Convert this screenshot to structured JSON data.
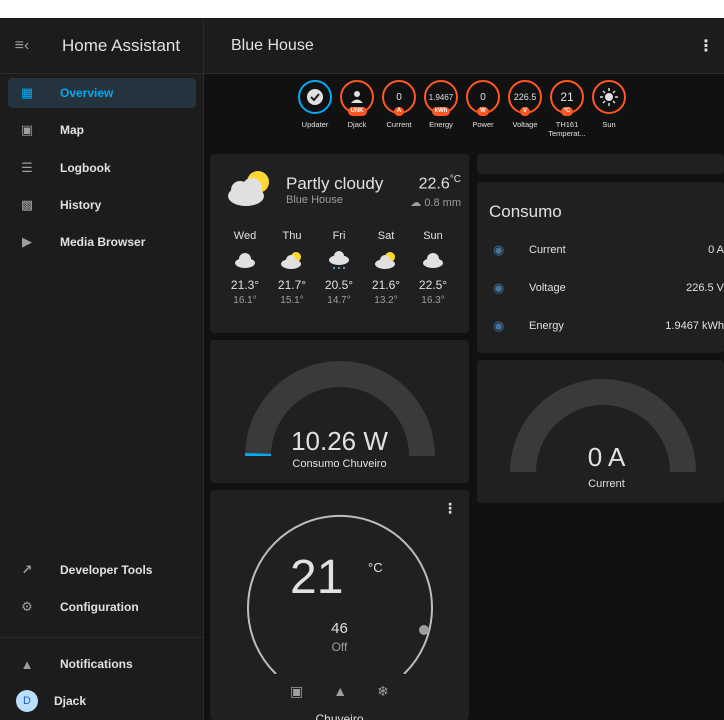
{
  "sidebar": {
    "title": "Home Assistant",
    "items": [
      {
        "label": "Overview",
        "icon": "view-dashboard-icon"
      },
      {
        "label": "Map",
        "icon": "map-icon"
      },
      {
        "label": "Logbook",
        "icon": "logbook-icon"
      },
      {
        "label": "History",
        "icon": "history-icon"
      },
      {
        "label": "Media Browser",
        "icon": "media-browser-icon"
      }
    ],
    "bottom": [
      {
        "label": "Developer Tools",
        "icon": "hammer-icon"
      },
      {
        "label": "Configuration",
        "icon": "cog-icon"
      },
      {
        "label": "Notifications",
        "icon": "bell-icon"
      }
    ],
    "user": {
      "name": "Djack",
      "initial": "D"
    }
  },
  "header": {
    "title": "Blue House"
  },
  "badges": [
    {
      "label": "Updater",
      "value": "",
      "unit": "",
      "icon": "check-icon"
    },
    {
      "label": "Djack",
      "value": "",
      "unit": "UNK",
      "icon": "person-icon"
    },
    {
      "label": "Current",
      "value": "0",
      "unit": "A"
    },
    {
      "label": "Energy",
      "value": "1.9467",
      "unit": "kWh"
    },
    {
      "label": "Power",
      "value": "0",
      "unit": "W"
    },
    {
      "label": "Voltage",
      "value": "226.5",
      "unit": "V"
    },
    {
      "label": "TH161 Temperat...",
      "value": "21",
      "unit": "°C"
    },
    {
      "label": "Sun",
      "value": "",
      "unit": "",
      "icon": "sun-icon"
    }
  ],
  "weather": {
    "condition": "Partly cloudy",
    "location": "Blue House",
    "temperature": "22.6",
    "temp_unit": "°C",
    "precipitation": "0.8 mm",
    "forecast": [
      {
        "day": "Wed",
        "high": "21.3°",
        "low": "16.1°",
        "icon": "cloud-icon"
      },
      {
        "day": "Thu",
        "high": "21.7°",
        "low": "15.1°",
        "icon": "partly-cloudy-icon"
      },
      {
        "day": "Fri",
        "high": "20.5°",
        "low": "14.7°",
        "icon": "snowy-icon"
      },
      {
        "day": "Sat",
        "high": "21.6°",
        "low": "13.2°",
        "icon": "partly-cloudy-icon"
      },
      {
        "day": "Sun",
        "high": "22.5°",
        "low": "16.3°",
        "icon": "cloud-icon"
      }
    ]
  },
  "gauge_power": {
    "value": "10.26 W",
    "name": "Consumo Chuveiro",
    "fraction": 0.01
  },
  "thermostat": {
    "current": "21",
    "unit": "°C",
    "target": "46",
    "state": "Off",
    "name": "Chuveiro"
  },
  "consumo": {
    "title": "Consumo",
    "entities": [
      {
        "name": "Current",
        "value": "0 A"
      },
      {
        "name": "Voltage",
        "value": "226.5 V"
      },
      {
        "name": "Energy",
        "value": "1.9467 kWh"
      }
    ]
  },
  "gauge_current": {
    "value": "0 A",
    "name": "Current",
    "fraction": 0
  },
  "colors": {
    "accent": "#03a9f4",
    "badge": "#ff5722",
    "eye": "#44739e",
    "card": "#202020"
  }
}
